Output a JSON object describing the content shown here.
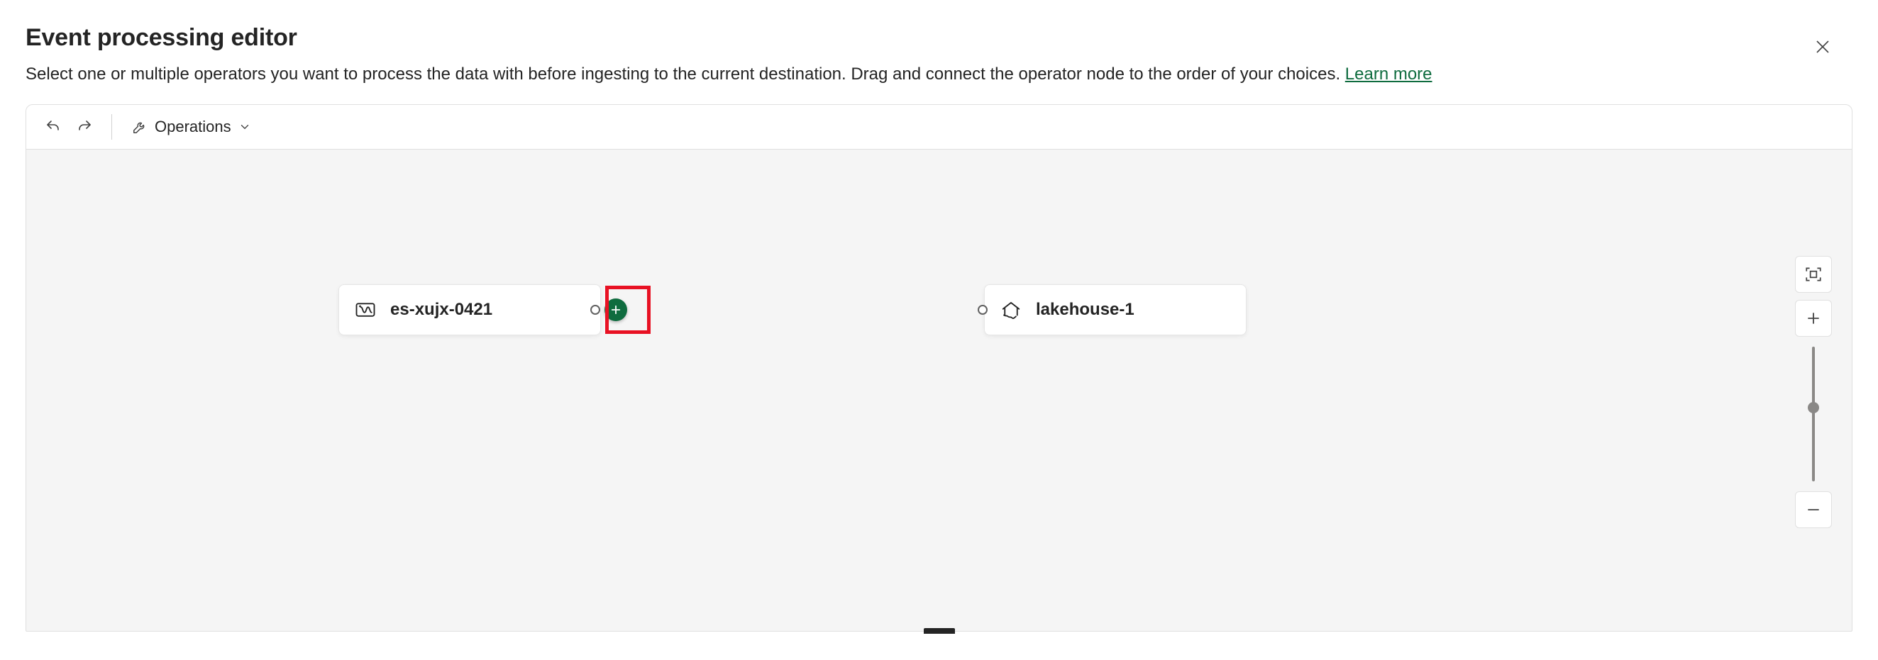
{
  "header": {
    "title": "Event processing editor",
    "subtitle": "Select one or multiple operators you want to process the data with before ingesting to the current destination. Drag and connect the operator node to the order of your choices. ",
    "learn_more_label": "Learn more"
  },
  "toolbar": {
    "operations_label": "Operations"
  },
  "nodes": {
    "source": {
      "label": "es-xujx-0421",
      "icon": "eventstream-icon"
    },
    "destination": {
      "label": "lakehouse-1",
      "icon": "lakehouse-icon"
    }
  },
  "zoom": {
    "thumb_percent": 45
  },
  "colors": {
    "accent": "#0f6c3f",
    "highlight": "#e81123",
    "canvas_bg": "#f5f5f5"
  }
}
